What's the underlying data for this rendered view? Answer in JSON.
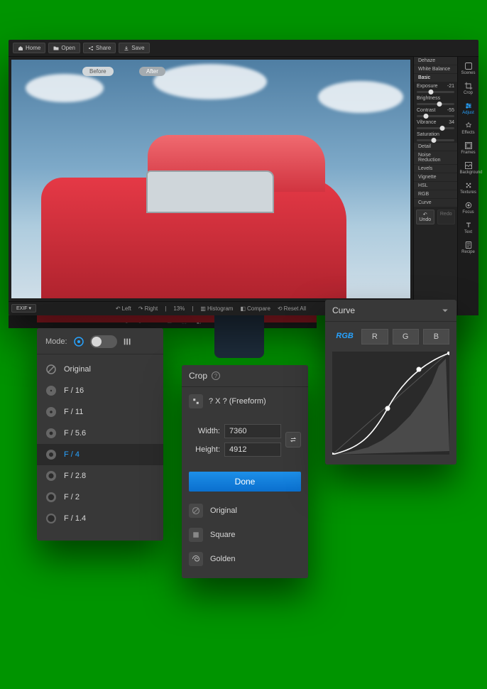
{
  "topbar": {
    "home": "Home",
    "open": "Open",
    "share": "Share",
    "save": "Save"
  },
  "canvas": {
    "before_label": "Before",
    "after_label": "After",
    "exif_label": "EXIF"
  },
  "footer": {
    "left": "Left",
    "right": "Right",
    "zoom": "13%",
    "histogram": "Histogram",
    "compare": "Compare",
    "reset": "Reset All"
  },
  "adjust": {
    "sections": [
      "Dehaze",
      "White Balance",
      "Basic"
    ],
    "sliders": [
      {
        "label": "Exposure",
        "value": -21,
        "pos": 38
      },
      {
        "label": "Brightness",
        "value": "",
        "pos": 60
      },
      {
        "label": "Contrast",
        "value": -55,
        "pos": 25
      },
      {
        "label": "Vibrance",
        "value": 34,
        "pos": 68
      },
      {
        "label": "Saturation",
        "value": "",
        "pos": 45
      }
    ],
    "more_sections": [
      "Detail",
      "Noise Reduction",
      "Levels",
      "Vignette",
      "HSL",
      "RGB",
      "Curve"
    ],
    "undo": "Undo",
    "redo": "Redo"
  },
  "toolrail": {
    "items": [
      {
        "label": "Scenes"
      },
      {
        "label": "Crop"
      },
      {
        "label": "Adjust",
        "active": true
      },
      {
        "label": "Effects"
      },
      {
        "label": "Frames"
      },
      {
        "label": "Background"
      },
      {
        "label": "Textures"
      },
      {
        "label": "Focus"
      },
      {
        "label": "Text"
      },
      {
        "label": "Recipe"
      }
    ]
  },
  "fpanel": {
    "mode_label": "Mode:",
    "items": [
      {
        "label": "Original",
        "icon": "none"
      },
      {
        "label": "F / 16",
        "icon": "ap-tiny"
      },
      {
        "label": "F / 11",
        "icon": "ap-small"
      },
      {
        "label": "F / 5.6",
        "icon": "ap-med"
      },
      {
        "label": "F / 4",
        "icon": "ap-sel",
        "selected": true
      },
      {
        "label": "F / 2.8",
        "icon": "ap-lg"
      },
      {
        "label": "F / 2",
        "icon": "ap-xl"
      },
      {
        "label": "F / 1.4",
        "icon": "ap-xxl"
      }
    ]
  },
  "crop": {
    "title": "Crop",
    "freeform": "? X ? (Freeform)",
    "width_label": "Width:",
    "height_label": "Height:",
    "width": "7360",
    "height": "4912",
    "done": "Done",
    "ratios": [
      {
        "label": "Original",
        "icon": "none"
      },
      {
        "label": "Square",
        "icon": "square"
      },
      {
        "label": "Golden",
        "icon": "golden"
      }
    ]
  },
  "curve": {
    "title": "Curve",
    "channels": [
      "RGB",
      "R",
      "G",
      "B"
    ],
    "active": "RGB"
  }
}
